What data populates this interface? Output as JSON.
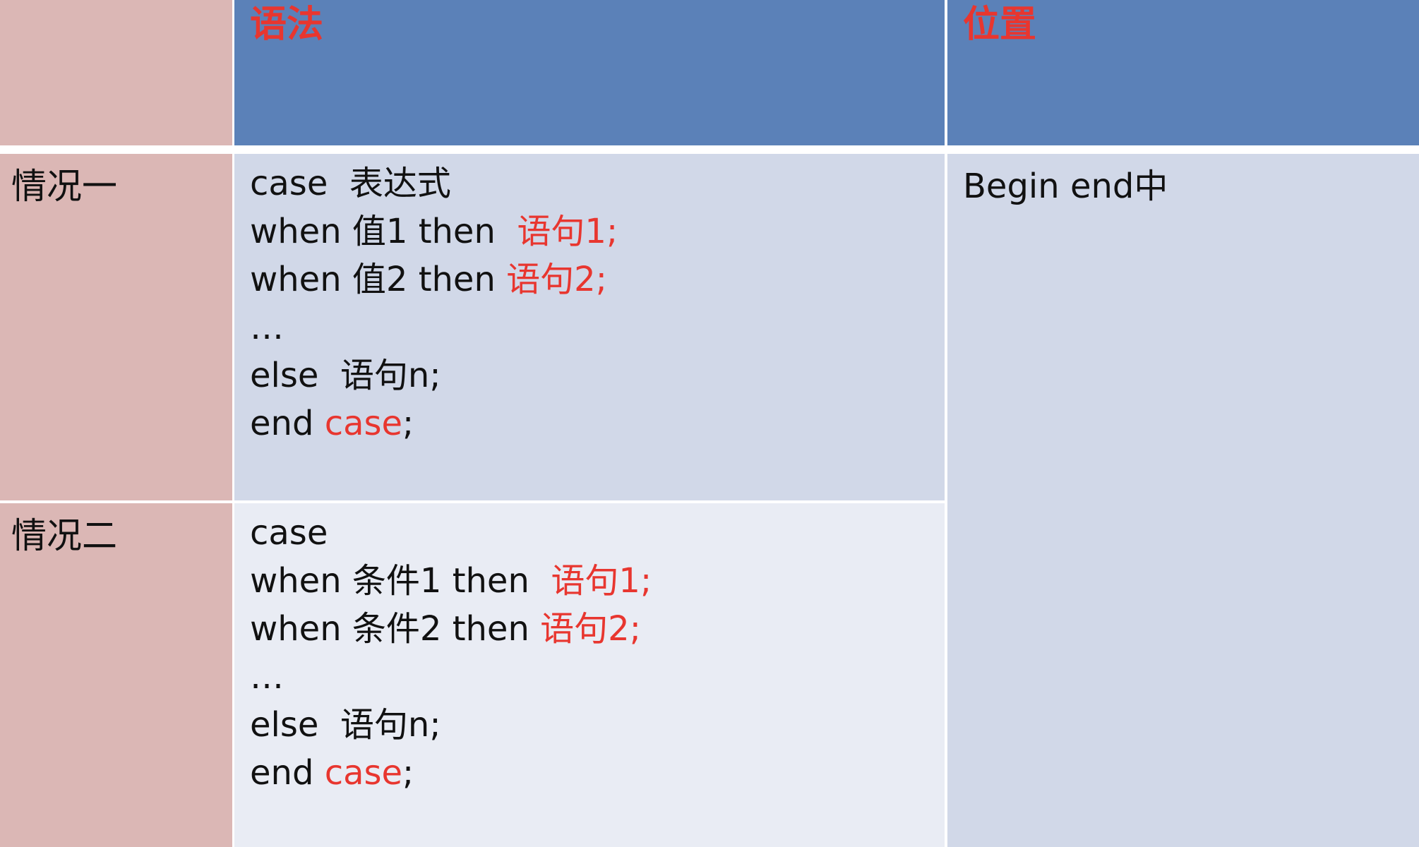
{
  "header": {
    "syntax": "语法",
    "location": "位置"
  },
  "rows": [
    {
      "label": "情况一",
      "lines": [
        {
          "text": "case  表达式",
          "highlight": ""
        },
        {
          "text": "when 值1 then  ",
          "highlight": "语句1;"
        },
        {
          "text": "when 值2 then ",
          "highlight": "语句2;"
        },
        {
          "text": "…",
          "highlight": ""
        },
        {
          "text": "else  语句n;",
          "highlight": ""
        },
        {
          "text": "end ",
          "highlight": "case",
          "tail": ";"
        }
      ]
    },
    {
      "label": "情况二",
      "lines": [
        {
          "text": "case",
          "highlight": ""
        },
        {
          "text": "when 条件1 then  ",
          "highlight": "语句1;"
        },
        {
          "text": "when 条件2 then ",
          "highlight": "语句2;"
        },
        {
          "text": "…",
          "highlight": ""
        },
        {
          "text": "else  语句n;",
          "highlight": ""
        },
        {
          "text": "end ",
          "highlight": "case",
          "tail": ";"
        }
      ]
    }
  ],
  "location": "Begin end中",
  "colors": {
    "header_bg": "#5b81b8",
    "label_bg": "#dbb7b5",
    "row1_bg": "#d1d8e8",
    "row2_bg": "#e9ecf4",
    "highlight": "#e8362f"
  }
}
